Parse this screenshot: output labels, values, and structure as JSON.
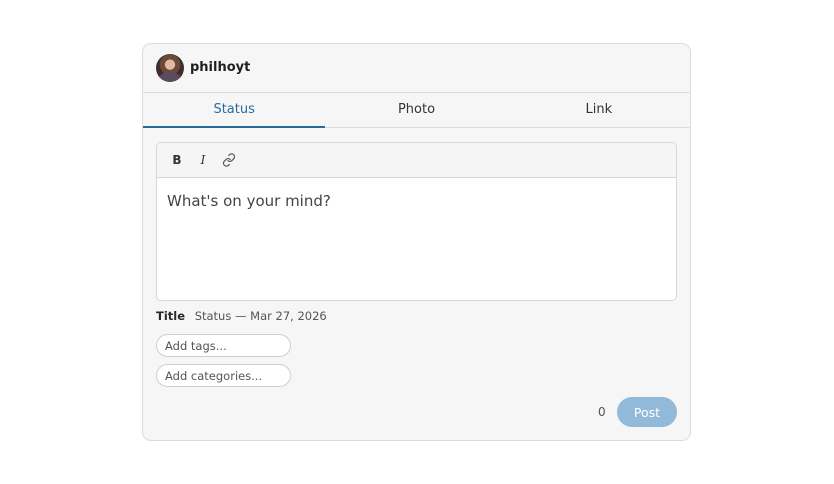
{
  "user": {
    "username": "philhoyt"
  },
  "tabs": [
    {
      "label": "Status",
      "active": true
    },
    {
      "label": "Photo",
      "active": false
    },
    {
      "label": "Link",
      "active": false
    }
  ],
  "toolbar": {
    "bold_label": "B",
    "italic_label": "I",
    "link_icon": "link-icon"
  },
  "editor": {
    "placeholder": "What's on your mind?"
  },
  "title": {
    "label": "Title",
    "value": "Status — Mar 27, 2026"
  },
  "tags": {
    "placeholder": "Add tags..."
  },
  "categories": {
    "placeholder": "Add categories..."
  },
  "footer": {
    "count": "0",
    "post_label": "Post"
  },
  "colors": {
    "accent": "#2a6b9c",
    "post_button": "#93b9d8"
  }
}
